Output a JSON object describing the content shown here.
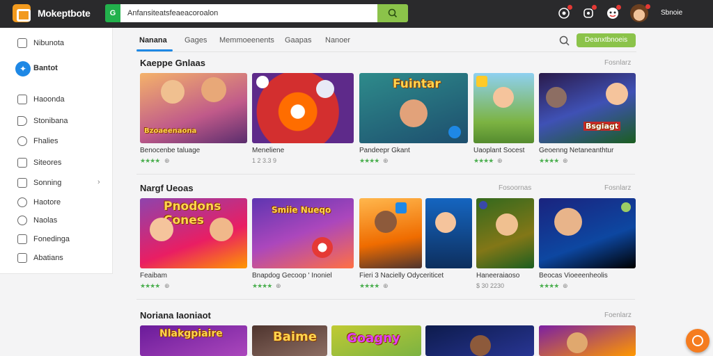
{
  "header": {
    "brand": "Mokeptbote",
    "search_tag": "G",
    "search_value": "Anfansiteatsfeaeacoroalon",
    "user_name": "Sbnoie"
  },
  "sidebar": {
    "items": [
      {
        "label": "Nibunota",
        "icon": "grid-icon"
      },
      {
        "label": "Bantot",
        "icon": "compass-icon",
        "active": true
      },
      {
        "label": "Haoonda",
        "icon": "home-icon"
      },
      {
        "label": "Stonibana",
        "icon": "tag-icon"
      },
      {
        "label": "Fhalies",
        "icon": "clock-icon"
      },
      {
        "label": "Siteores",
        "icon": "flag-icon"
      },
      {
        "label": "Sonning",
        "icon": "folder-icon",
        "chevron": "›"
      },
      {
        "label": "Haotore",
        "icon": "info-icon"
      },
      {
        "label": "Naolas",
        "icon": "circle-icon"
      },
      {
        "label": "Fonedinga",
        "icon": "box-icon"
      },
      {
        "label": "Abatians",
        "icon": "box-icon"
      }
    ]
  },
  "tabs": [
    "Nanana",
    "Gages",
    "Memmoeenents",
    "Gaapas",
    "Nanoer"
  ],
  "action_button": "Deanxtbnoeis",
  "sections": [
    {
      "title": "Kaeppe Gnlaas",
      "see_all": "Fosnlarz",
      "extra_link": "",
      "cards": [
        {
          "title": "Benocenbe taluage",
          "stars": "★★★★",
          "price": "⊕",
          "banner": "Bzoaeenaona"
        },
        {
          "title": "Meneliene",
          "stars": "",
          "price": "1 2 3.3 9",
          "banner": ""
        },
        {
          "title": "Pandeepr Gkant",
          "stars": "★★★★",
          "price": "⊕",
          "banner": "Fuintar"
        },
        {
          "title": "Uaoplant Socest",
          "stars": "★★★★",
          "price": "⊕",
          "banner": ""
        },
        {
          "title": "Geoenng Netaneanthtur",
          "stars": "★★★★",
          "price": "⊕",
          "banner": "Bsgiagt"
        }
      ]
    },
    {
      "title": "Nargf Ueoas",
      "see_all": "Fosnlarz",
      "extra_link": "Fosoornas",
      "cards": [
        {
          "title": "Feaibam",
          "stars": "★★★★",
          "price": "⊕",
          "banner": "Pnodons Cones"
        },
        {
          "title": "Bnapdog Gecoop  ' Inoniel",
          "stars": "★★★★",
          "price": "⊕",
          "banner": "Smiie Nueqo"
        },
        {
          "title": "Fieri 3 Nacielly Odyceriticet",
          "stars": "★★★★",
          "price": "⊕",
          "banner": ""
        },
        {
          "title": "Haneeraiaoso",
          "stars": "",
          "price": "$ 30 2230",
          "banner": ""
        },
        {
          "title": "Beocas Vioeeenheolis",
          "stars": "★★★★",
          "price": "⊕",
          "banner": ""
        }
      ]
    },
    {
      "title": "Noriana Iaoniaot",
      "see_all": "Foenlarz",
      "extra_link": "",
      "cards": [
        {
          "title": "",
          "stars": "",
          "price": "",
          "banner": "Nlakgpiaire"
        },
        {
          "title": "",
          "stars": "",
          "price": "",
          "banner": "Baime"
        },
        {
          "title": "",
          "stars": "",
          "price": "",
          "banner": "Goagny"
        },
        {
          "title": "",
          "stars": "",
          "price": "",
          "banner": ""
        },
        {
          "title": "",
          "stars": "",
          "price": "",
          "banner": ""
        }
      ]
    }
  ],
  "colors": {
    "topbar": "#2a2a2c",
    "accent_blue": "#1e88e5",
    "accent_green": "#8bc34a",
    "brand_orange": "#f29a1e",
    "fab_orange": "#f57c1f"
  }
}
